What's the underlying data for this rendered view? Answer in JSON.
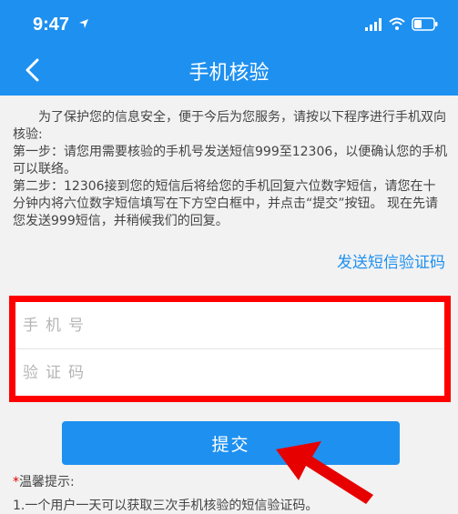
{
  "status_bar": {
    "time": "9:47",
    "icons": [
      "location-arrow-icon",
      "signal-icon",
      "wifi-icon",
      "battery-icon"
    ]
  },
  "nav": {
    "title": "手机核验",
    "back_icon": "chevron-left-icon"
  },
  "intro": {
    "p1": "为了保护您的信息安全，便于今后为您服务，请按以下程序进行手机双向核验:",
    "p2": "第一步：请您用需要核验的手机号发送短信999至12306，以便确认您的手机可以联络。",
    "p3": "第二步：12306接到您的短信后将给您的手机回复六位数字短信，请您在十分钟内将六位数字短信填写在下方空白框中，并点击“提交”按钮。 现在先请您发送999短信，并稍候我们的回复。"
  },
  "send_code_link": "发送短信验证码",
  "form": {
    "phone_placeholder": "手机号",
    "code_placeholder": "验证码",
    "phone_value": "",
    "code_value": ""
  },
  "submit_label": "提交",
  "tips": {
    "star": "*",
    "title": "温馨提示:",
    "line1": "1.一个用户一天可以获取三次手机核验的短信验证码。"
  },
  "colors": {
    "primary": "#1e90f0",
    "highlight_border": "#ff0000",
    "annotation_arrow": "#e60000"
  }
}
